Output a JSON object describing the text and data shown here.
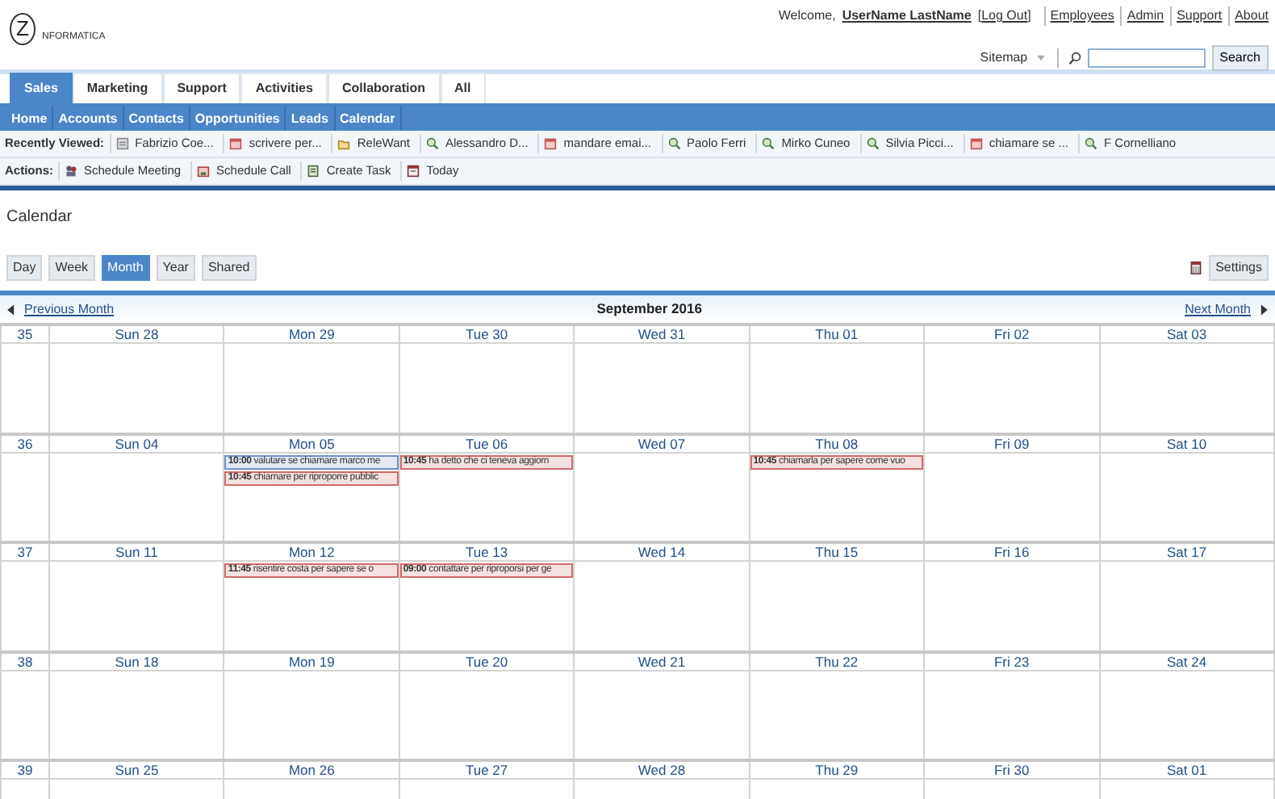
{
  "header": {
    "logo_text": "NFORMATICA",
    "logo_letter": "Z",
    "welcome": "Welcome,",
    "user": "UserName LastName",
    "logout_open": "[",
    "logout": "Log Out",
    "logout_close": "]",
    "links": [
      "Employees",
      "Admin",
      "Support",
      "About"
    ],
    "sitemap": "Sitemap",
    "search_button": "Search"
  },
  "tabs": [
    {
      "label": "Sales",
      "selected": true
    },
    {
      "label": "Marketing",
      "selected": false
    },
    {
      "label": "Support",
      "selected": false
    },
    {
      "label": "Activities",
      "selected": false
    },
    {
      "label": "Collaboration",
      "selected": false
    },
    {
      "label": "All",
      "selected": false
    }
  ],
  "subnav": [
    "Home",
    "Accounts",
    "Contacts",
    "Opportunities",
    "Leads",
    "Calendar"
  ],
  "recently_viewed": {
    "label": "Recently Viewed:",
    "items": [
      {
        "label": "Fabrizio Coe...",
        "kind": "document"
      },
      {
        "label": "scrivere per...",
        "kind": "calendar"
      },
      {
        "label": "ReleWant",
        "kind": "folder"
      },
      {
        "label": "Alessandro D...",
        "kind": "contact"
      },
      {
        "label": "mandare emai...",
        "kind": "calendar"
      },
      {
        "label": "Paolo Ferri",
        "kind": "contact"
      },
      {
        "label": "Mirko Cuneo",
        "kind": "contact"
      },
      {
        "label": "Silvia Picci...",
        "kind": "contact"
      },
      {
        "label": "chiamare se ...",
        "kind": "calendar"
      },
      {
        "label": "F Cornelliano",
        "kind": "contact"
      }
    ]
  },
  "actions": {
    "label": "Actions:",
    "items": [
      {
        "label": "Schedule Meeting",
        "kind": "meeting"
      },
      {
        "label": "Schedule Call",
        "kind": "call"
      },
      {
        "label": "Create Task",
        "kind": "task"
      },
      {
        "label": "Today",
        "kind": "today"
      }
    ]
  },
  "page_title": "Calendar",
  "views": [
    {
      "label": "Day",
      "selected": false
    },
    {
      "label": "Week",
      "selected": false
    },
    {
      "label": "Month",
      "selected": true
    },
    {
      "label": "Year",
      "selected": false
    },
    {
      "label": "Shared",
      "selected": false
    }
  ],
  "settings_button": "Settings",
  "prev_month": "Previous Month",
  "month_title": "September 2016",
  "next_month": "Next Month",
  "weeks": [
    {
      "number": "35",
      "days": [
        {
          "label": "Sun 28"
        },
        {
          "label": "Mon 29"
        },
        {
          "label": "Tue 30"
        },
        {
          "label": "Wed 31"
        },
        {
          "label": "Thu 01"
        },
        {
          "label": "Fri 02"
        },
        {
          "label": "Sat 03"
        }
      ]
    },
    {
      "number": "36",
      "days": [
        {
          "label": "Sun 04"
        },
        {
          "label": "Mon 05",
          "events": [
            {
              "time": "10:00",
              "text": "valutare se chiamare marco me",
              "color": "#6f93c9"
            },
            {
              "time": "10:45",
              "text": "chiamare per riproporre pubblic",
              "color": "#cf6b6b"
            }
          ]
        },
        {
          "label": "Tue 06",
          "events": [
            {
              "time": "10:45",
              "text": "ha detto che ci teneva aggiorn",
              "color": "#cf6b6b"
            }
          ]
        },
        {
          "label": "Wed 07"
        },
        {
          "label": "Thu 08",
          "events": [
            {
              "time": "10:45",
              "text": "chiamarla per sapere come vuo",
              "color": "#cf6b6b"
            }
          ]
        },
        {
          "label": "Fri 09"
        },
        {
          "label": "Sat 10"
        }
      ]
    },
    {
      "number": "37",
      "days": [
        {
          "label": "Sun 11"
        },
        {
          "label": "Mon 12",
          "events": [
            {
              "time": "11:45",
              "text": "risentire costa per sapere se o",
              "color": "#cf6b6b"
            }
          ]
        },
        {
          "label": "Tue 13",
          "events": [
            {
              "time": "09:00",
              "text": "contattare per riproporsi per ge",
              "color": "#cf6b6b"
            }
          ]
        },
        {
          "label": "Wed 14"
        },
        {
          "label": "Thu 15"
        },
        {
          "label": "Fri 16"
        },
        {
          "label": "Sat 17"
        }
      ]
    },
    {
      "number": "38",
      "days": [
        {
          "label": "Sun 18"
        },
        {
          "label": "Mon 19"
        },
        {
          "label": "Tue 20"
        },
        {
          "label": "Wed 21"
        },
        {
          "label": "Thu 22"
        },
        {
          "label": "Fri 23"
        },
        {
          "label": "Sat 24"
        }
      ]
    },
    {
      "number": "39",
      "days": [
        {
          "label": "Sun 25"
        },
        {
          "label": "Mon 26"
        },
        {
          "label": "Tue 27"
        },
        {
          "label": "Wed 28"
        },
        {
          "label": "Thu 29"
        },
        {
          "label": "Fri 30"
        },
        {
          "label": "Sat 01"
        }
      ]
    }
  ]
}
